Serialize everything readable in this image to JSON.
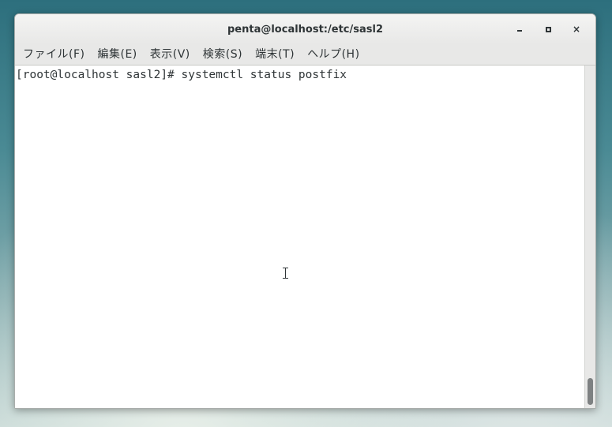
{
  "window": {
    "title": "penta@localhost:/etc/sasl2",
    "controls": {
      "minimize_icon": "minimize-icon",
      "maximize_icon": "maximize-icon",
      "close_icon": "close-icon",
      "close_glyph": "×"
    }
  },
  "menubar": {
    "items": [
      {
        "label": "ファイル(F)"
      },
      {
        "label": "編集(E)"
      },
      {
        "label": "表示(V)"
      },
      {
        "label": "検索(S)"
      },
      {
        "label": "端末(T)"
      },
      {
        "label": "ヘルプ(H)"
      }
    ]
  },
  "terminal": {
    "lines": [
      {
        "text": "[root@localhost sasl2]# systemctl status postfix"
      }
    ]
  },
  "colors": {
    "text": "#2e3436",
    "chrome": "#e8e8e7",
    "terminal_bg": "#ffffff"
  }
}
